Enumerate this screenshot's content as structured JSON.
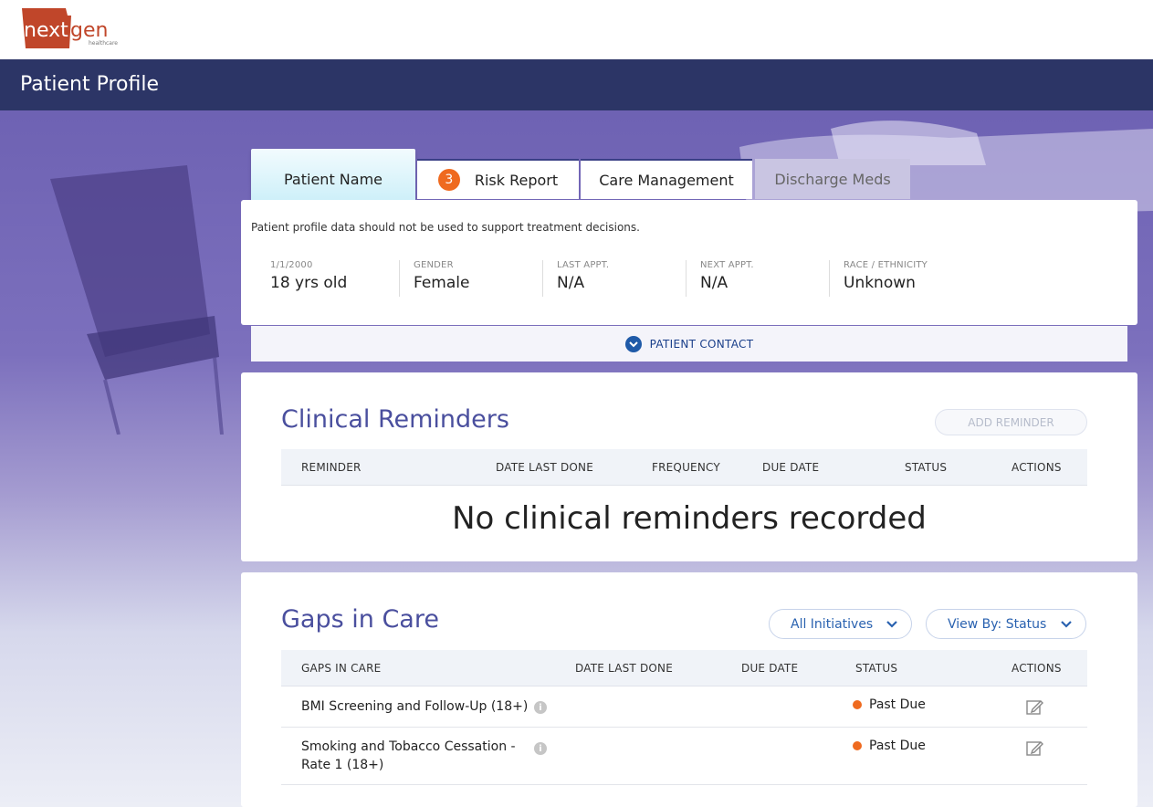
{
  "brand": {
    "logo_text_left": "next",
    "logo_text_right": "gen",
    "logo_sub": "healthcare"
  },
  "header": {
    "title": "Patient Profile"
  },
  "tabs": [
    {
      "label": "Patient Name"
    },
    {
      "label": "Risk Report",
      "badge": "3"
    },
    {
      "label": "Care Management"
    },
    {
      "label": "Discharge Meds"
    }
  ],
  "profile": {
    "disclaimer": "Patient profile data should not be used to support treatment decisions.",
    "fields": [
      {
        "label": "1/1/2000",
        "value": "18 yrs old"
      },
      {
        "label": "GENDER",
        "value": "Female"
      },
      {
        "label": "LAST APPT.",
        "value": "N/A"
      },
      {
        "label": "NEXT APPT.",
        "value": "N/A"
      },
      {
        "label": "RACE / ETHNICITY",
        "value": "Unknown"
      }
    ],
    "contact_label": "PATIENT CONTACT"
  },
  "reminders": {
    "title": "Clinical Reminders",
    "add_button": "ADD REMINDER",
    "columns": [
      "REMINDER",
      "DATE LAST DONE",
      "FREQUENCY",
      "DUE DATE",
      "STATUS",
      "ACTIONS"
    ],
    "empty_message": "No clinical reminders recorded"
  },
  "gaps": {
    "title": "Gaps in Care",
    "filter_initiatives": "All Initiatives",
    "filter_view": "View By: Status",
    "columns": [
      "GAPS IN CARE",
      "DATE LAST DONE",
      "DUE DATE",
      "STATUS",
      "ACTIONS"
    ],
    "rows": [
      {
        "name": "BMI Screening and Follow-Up (18+)",
        "status": "Past Due"
      },
      {
        "name_line1": "Smoking and Tobacco Cessation -",
        "name_line2": "Rate 1 (18+)",
        "status": "Past Due"
      }
    ]
  },
  "colors": {
    "header": "#2c3566",
    "accent": "#4a4f9e",
    "badge": "#ef6a1f",
    "past_due": "#ef6a1f",
    "link": "#2a62b0"
  }
}
